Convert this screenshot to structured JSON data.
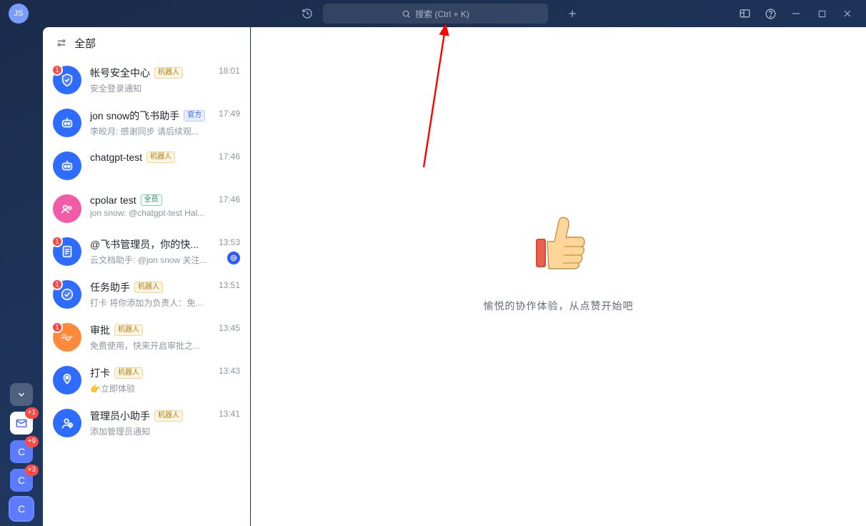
{
  "user": {
    "initials": "JS"
  },
  "search": {
    "placeholder": "搜索 (Ctrl + K)"
  },
  "filter": {
    "label": "全部"
  },
  "rail": {
    "mail_badge": "+1",
    "c1_badge": "+9",
    "c2_badge": "+3",
    "c_letter": "C"
  },
  "empty": {
    "text": "愉悦的协作体验，从点赞开始吧"
  },
  "conversations": [
    {
      "name": "帐号安全中心",
      "tag": "机器人",
      "tagClass": "bot",
      "preview": "安全登录通知",
      "time": "18:01",
      "badge": "1",
      "avColor": "#2e6bff",
      "avIcon": "shield"
    },
    {
      "name": "jon snow的飞书助手",
      "tag": "官方",
      "tagClass": "off",
      "preview": "李皎月: 感谢同步 请后续观...",
      "time": "17:49",
      "avColor": "#2e6bff",
      "avIcon": "robot"
    },
    {
      "name": "chatgpt-test",
      "tag": "机器人",
      "tagClass": "bot",
      "preview": "",
      "time": "17:46",
      "avColor": "#2e6bff",
      "avIcon": "robot"
    },
    {
      "name": "cpolar test",
      "tag": "全员",
      "tagClass": "all",
      "preview": "jon snow: @chatgpt-test Hal...",
      "time": "17:46",
      "avColor": "#f25ba8",
      "avIcon": "group"
    },
    {
      "name": "@飞书管理员，你的快...",
      "tag": "",
      "preview": "云文档助手: @jon snow 关注...",
      "time": "13:53",
      "badge": "1",
      "extraIcon": true,
      "avColor": "#2e6bff",
      "avIcon": "doc"
    },
    {
      "name": "任务助手",
      "tag": "机器人",
      "tagClass": "bot",
      "preview": "打卡 将你添加为负责人：免...",
      "time": "13:51",
      "badge": "1",
      "avColor": "#2e6bff",
      "avIcon": "check"
    },
    {
      "name": "审批",
      "tag": "机器人",
      "tagClass": "bot",
      "preview": "免费使用，快来开启审批之...",
      "time": "13:45",
      "badge": "1",
      "avColor": "#ff8a3c",
      "avIcon": "wave"
    },
    {
      "name": "打卡",
      "tag": "机器人",
      "tagClass": "bot",
      "preview": "👉立即体验",
      "time": "13:43",
      "avColor": "#2e6bff",
      "avIcon": "pin"
    },
    {
      "name": "管理员小助手",
      "tag": "机器人",
      "tagClass": "bot",
      "preview": "添加管理员通知",
      "time": "13:41",
      "avColor": "#2e6bff",
      "avIcon": "admin"
    }
  ]
}
